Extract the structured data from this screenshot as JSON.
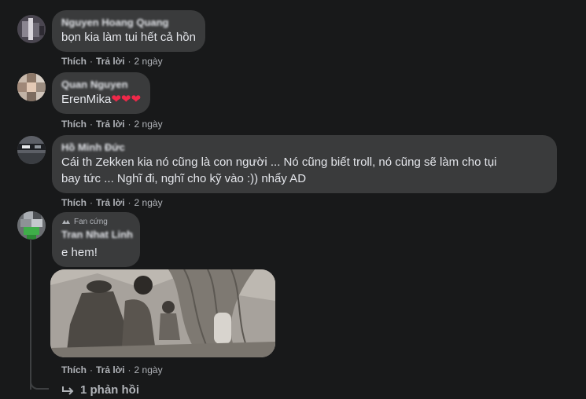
{
  "comments": [
    {
      "author": "Nguyen Hoang Quang",
      "text": "bọn kia làm tui hết cả hồn",
      "like_label": "Thích",
      "reply_label": "Trả lời",
      "time": "2 ngày"
    },
    {
      "author": "Quan Nguyen",
      "text": "ErenMika",
      "hearts": "❤❤❤",
      "like_label": "Thích",
      "reply_label": "Trả lời",
      "time": "2 ngày"
    },
    {
      "author": "Hồ Minh Đức",
      "text_line1": "Cái th Zekken kia nó cũng là con người ... Nó cũng biết troll, nó cũng sẽ làm cho tụi",
      "text_line2": "bay tức ... Nghĩ đi, nghĩ cho kỹ vào :)) nhẩy AD",
      "like_label": "Thích",
      "reply_label": "Trả lời",
      "time": "2 ngày"
    },
    {
      "badge": "Fan cứng",
      "author": "Tran Nhat Linh",
      "text": "e hem!",
      "like_label": "Thích",
      "reply_label": "Trả lời",
      "time": "2 ngày",
      "photo_icon": "manga-panel-image"
    }
  ],
  "replies_link": "1 phản hồi",
  "colors": {
    "background": "#18191a",
    "bubble": "#3a3b3c",
    "text": "#e4e6eb",
    "secondary": "#b0b3b8",
    "heart": "#f02849"
  }
}
